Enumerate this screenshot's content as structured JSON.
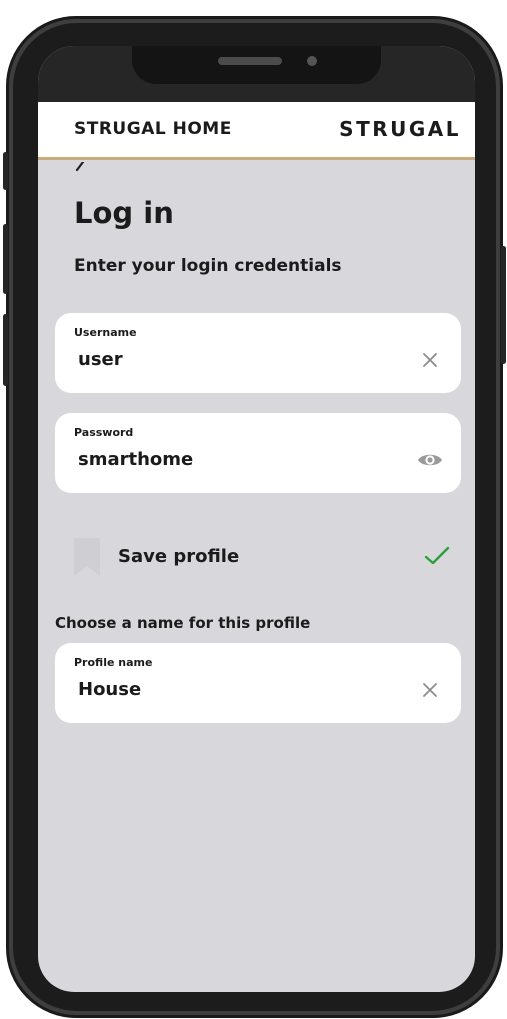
{
  "header": {
    "title": "STRUGAL HOME",
    "brand": "STRUGAL"
  },
  "back": {
    "icon": "chevron-left-icon"
  },
  "page": {
    "title": "Log in",
    "subtitle": "Enter your login credentials"
  },
  "username": {
    "label": "Username",
    "value": "user",
    "icon": "clear-icon"
  },
  "password": {
    "label": "Password",
    "value": "smarthome",
    "icon": "eye-icon"
  },
  "save_profile": {
    "label": "Save profile",
    "checked": true,
    "icon": "bookmark-icon",
    "check_icon": "check-icon"
  },
  "profile_section": {
    "label": "Choose a name for this profile"
  },
  "profile_name": {
    "label": "Profile name",
    "value": "House",
    "icon": "clear-icon"
  },
  "colors": {
    "accent_line": "#c7ad7c",
    "check": "#2e9e3a",
    "screen_bg": "#d8d8dc",
    "field_bg": "#ffffff"
  }
}
